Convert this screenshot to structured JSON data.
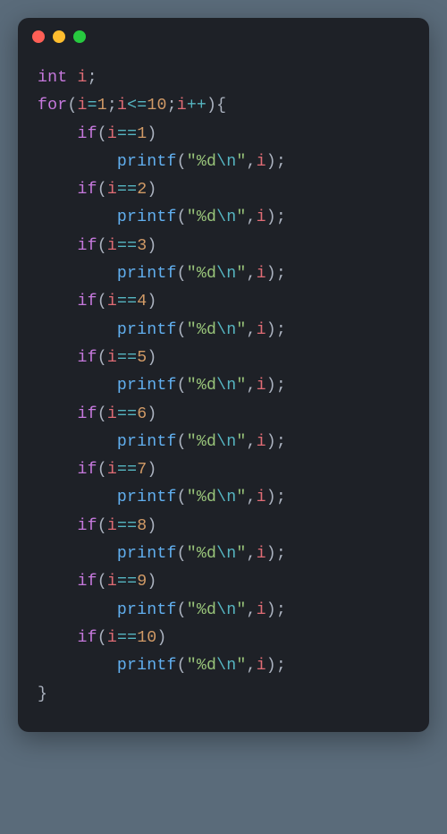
{
  "window": {
    "buttons": {
      "close": "close",
      "minimize": "minimize",
      "zoom": "zoom"
    }
  },
  "code": {
    "kw_int": "int",
    "kw_for": "for",
    "kw_if": "if",
    "var_i": "i",
    "fn_printf": "printf",
    "fmt_prefix": "\"",
    "fmt_body": "%d",
    "fmt_esc": "\\n",
    "fmt_suffix": "\"",
    "nums": {
      "n1": "1",
      "n2": "2",
      "n3": "3",
      "n4": "4",
      "n5": "5",
      "n6": "6",
      "n7": "7",
      "n8": "8",
      "n9": "9",
      "n10": "10"
    },
    "semi": ";",
    "lparen": "(",
    "rparen": ")",
    "lbrace": "{",
    "rbrace": "}",
    "comma": ",",
    "op_assign": "=",
    "op_le": "<=",
    "op_eq": "==",
    "op_inc": "++"
  }
}
